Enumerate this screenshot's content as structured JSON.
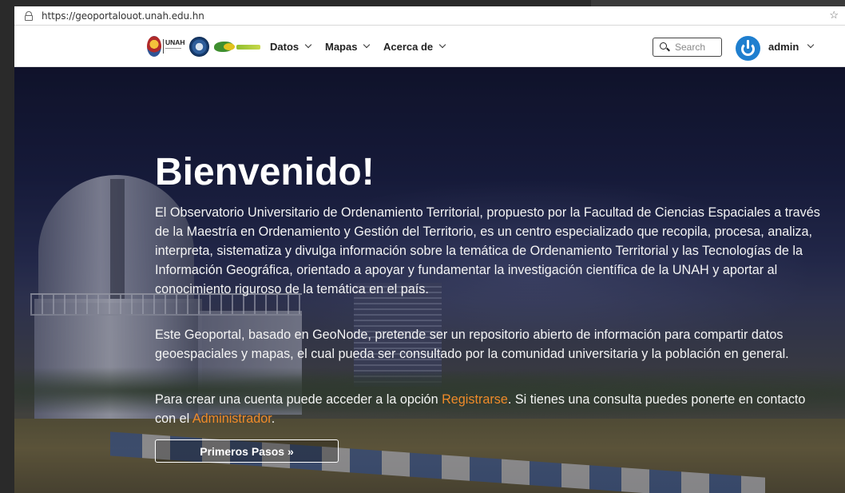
{
  "browser": {
    "url": "https://geoportalouot.unah.edu.hn"
  },
  "navbar": {
    "logos": [
      {
        "name": "unah-logo",
        "text": "UNAH"
      },
      {
        "name": "observatorio-logo"
      },
      {
        "name": "maestria-logo"
      }
    ],
    "menu": [
      {
        "label": "Datos"
      },
      {
        "label": "Mapas"
      },
      {
        "label": "Acerca de"
      }
    ],
    "search": {
      "placeholder": "Search"
    },
    "user": {
      "name": "admin"
    }
  },
  "hero": {
    "title": "Bienvenido!",
    "paragraph1": "El Observatorio Universitario de Ordenamiento Territorial, propuesto por la Facultad de Ciencias Espaciales a través de la Maestría en Ordenamiento y Gestión del Territorio, es un centro especializado que recopila, procesa, analiza, interpreta, sistematiza y divulga información sobre la temática de Ordenamiento Territorial y las Tecnologías de la Información Geográfica, orientado a apoyar y fundamentar la investigación científica de la UNAH y aportar al conocimiento riguroso de la temática en el país.",
    "paragraph2": "Este Geoportal, basado en GeoNode, pretende ser un repositorio abierto de información para compartir datos geoespaciales y mapas, el cual pueda ser consultado por la comunidad universitaria y la población en general.",
    "paragraph3": {
      "before": "Para crear una cuenta puede acceder a la opción ",
      "link1": "Registrarse",
      "middle": ". Si tienes una consulta puedes ponerte en contacto con el ",
      "link2": "Administrador",
      "after": "."
    },
    "button": "Primeros Pasos »"
  },
  "colors": {
    "link": "#ef8a2a",
    "avatar": "#1f7fcf"
  }
}
